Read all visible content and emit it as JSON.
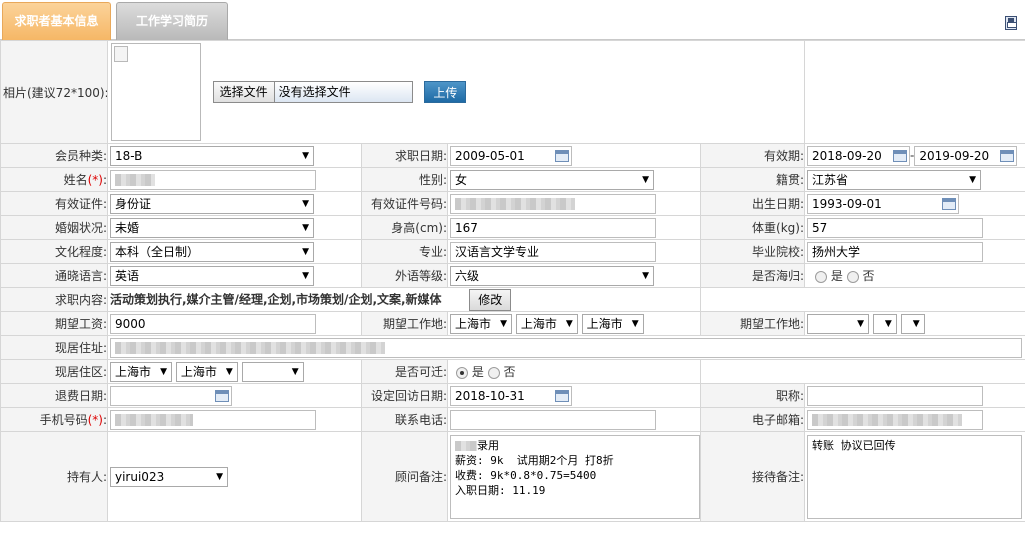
{
  "tabs": [
    {
      "label": "求职者基本信息",
      "active": true
    },
    {
      "label": "工作学习简历",
      "active": false
    }
  ],
  "photo": {
    "label": "相片(建议72*100):",
    "choose_file": "选择文件",
    "no_file": "没有选择文件",
    "upload": "上传"
  },
  "rows": {
    "member_type": {
      "label": "会员种类:",
      "value": "18-B"
    },
    "apply_date": {
      "label": "求职日期:",
      "value": "2009-05-01"
    },
    "valid_period": {
      "label": "有效期:",
      "from": "2018-09-20",
      "sep": "-",
      "to": "2019-09-20"
    },
    "name": {
      "label": "姓名",
      "req": "(*)",
      "colon": ":"
    },
    "gender": {
      "label": "性别:",
      "value": "女"
    },
    "native": {
      "label": "籍贯:",
      "value": "江苏省"
    },
    "id_type": {
      "label": "有效证件:",
      "value": "身份证"
    },
    "id_number": {
      "label": "有效证件号码:"
    },
    "birth": {
      "label": "出生日期:",
      "value": "1993-09-01"
    },
    "marital": {
      "label": "婚姻状况:",
      "value": "未婚"
    },
    "height": {
      "label": "身高(cm):",
      "value": "167"
    },
    "weight": {
      "label": "体重(kg):",
      "value": "57"
    },
    "education": {
      "label": "文化程度:",
      "value": "本科（全日制）"
    },
    "major": {
      "label": "专业:",
      "value": "汉语言文学专业"
    },
    "school": {
      "label": "毕业院校:",
      "value": "扬州大学"
    },
    "language": {
      "label": "通晓语言:",
      "value": "英语"
    },
    "foreign_level": {
      "label": "外语等级:",
      "value": "六级"
    },
    "overseas": {
      "label": "是否海归:",
      "yes": "是",
      "no": "否"
    },
    "job_content": {
      "label": "求职内容:",
      "value": "活动策划执行,媒介主管/经理,企划,市场策划/企划,文案,新媒体",
      "edit": "修改"
    },
    "salary": {
      "label": "期望工资:",
      "value": "9000"
    },
    "work_place1": {
      "label": "期望工作地:",
      "v1": "上海市",
      "v2": "上海市",
      "v3": "上海市"
    },
    "work_place2": {
      "label": "期望工作地:"
    },
    "address": {
      "label": "现居住址:"
    },
    "district": {
      "label": "现居住区:",
      "v1": "上海市",
      "v2": "上海市"
    },
    "relocate": {
      "label": "是否可迁:",
      "yes": "是",
      "no": "否"
    },
    "refund_date": {
      "label": "退费日期:"
    },
    "revisit_date": {
      "label": "设定回访日期:",
      "value": "2018-10-31"
    },
    "title": {
      "label": "职称:"
    },
    "mobile": {
      "label": "手机号码",
      "req": "(*)",
      "colon": ":"
    },
    "phone": {
      "label": "联系电话:"
    },
    "email": {
      "label": "电子邮箱:"
    },
    "holder": {
      "label": "持有人:",
      "value": "yirui023"
    },
    "advisor_note": {
      "label": "顾问备注:",
      "line1_suffix": "录用",
      "rest": "薪资: 9k  试用期2个月 打8折\n收费: 9k*0.8*0.75=5400\n入职日期: 11.19"
    },
    "reception_note": {
      "label": "接待备注:",
      "value": "转账 协议已回传"
    }
  },
  "icons": {
    "save": "save-icon",
    "calendar": "calendar-icon",
    "dropdown": "chevron-down-icon"
  }
}
